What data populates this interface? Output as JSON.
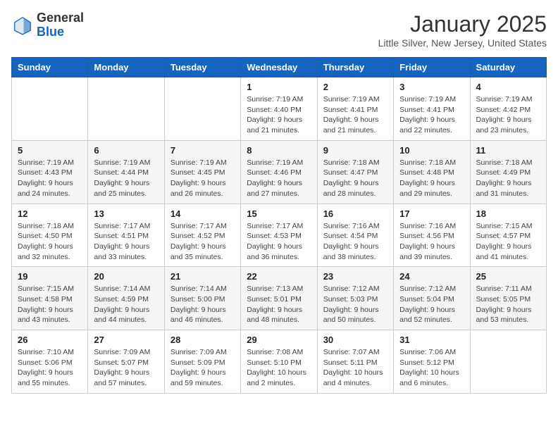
{
  "header": {
    "logo_general": "General",
    "logo_blue": "Blue",
    "month": "January 2025",
    "location": "Little Silver, New Jersey, United States"
  },
  "weekdays": [
    "Sunday",
    "Monday",
    "Tuesday",
    "Wednesday",
    "Thursday",
    "Friday",
    "Saturday"
  ],
  "weeks": [
    [
      {
        "day": "",
        "info": ""
      },
      {
        "day": "",
        "info": ""
      },
      {
        "day": "",
        "info": ""
      },
      {
        "day": "1",
        "info": "Sunrise: 7:19 AM\nSunset: 4:40 PM\nDaylight: 9 hours and 21 minutes."
      },
      {
        "day": "2",
        "info": "Sunrise: 7:19 AM\nSunset: 4:41 PM\nDaylight: 9 hours and 21 minutes."
      },
      {
        "day": "3",
        "info": "Sunrise: 7:19 AM\nSunset: 4:41 PM\nDaylight: 9 hours and 22 minutes."
      },
      {
        "day": "4",
        "info": "Sunrise: 7:19 AM\nSunset: 4:42 PM\nDaylight: 9 hours and 23 minutes."
      }
    ],
    [
      {
        "day": "5",
        "info": "Sunrise: 7:19 AM\nSunset: 4:43 PM\nDaylight: 9 hours and 24 minutes."
      },
      {
        "day": "6",
        "info": "Sunrise: 7:19 AM\nSunset: 4:44 PM\nDaylight: 9 hours and 25 minutes."
      },
      {
        "day": "7",
        "info": "Sunrise: 7:19 AM\nSunset: 4:45 PM\nDaylight: 9 hours and 26 minutes."
      },
      {
        "day": "8",
        "info": "Sunrise: 7:19 AM\nSunset: 4:46 PM\nDaylight: 9 hours and 27 minutes."
      },
      {
        "day": "9",
        "info": "Sunrise: 7:18 AM\nSunset: 4:47 PM\nDaylight: 9 hours and 28 minutes."
      },
      {
        "day": "10",
        "info": "Sunrise: 7:18 AM\nSunset: 4:48 PM\nDaylight: 9 hours and 29 minutes."
      },
      {
        "day": "11",
        "info": "Sunrise: 7:18 AM\nSunset: 4:49 PM\nDaylight: 9 hours and 31 minutes."
      }
    ],
    [
      {
        "day": "12",
        "info": "Sunrise: 7:18 AM\nSunset: 4:50 PM\nDaylight: 9 hours and 32 minutes."
      },
      {
        "day": "13",
        "info": "Sunrise: 7:17 AM\nSunset: 4:51 PM\nDaylight: 9 hours and 33 minutes."
      },
      {
        "day": "14",
        "info": "Sunrise: 7:17 AM\nSunset: 4:52 PM\nDaylight: 9 hours and 35 minutes."
      },
      {
        "day": "15",
        "info": "Sunrise: 7:17 AM\nSunset: 4:53 PM\nDaylight: 9 hours and 36 minutes."
      },
      {
        "day": "16",
        "info": "Sunrise: 7:16 AM\nSunset: 4:54 PM\nDaylight: 9 hours and 38 minutes."
      },
      {
        "day": "17",
        "info": "Sunrise: 7:16 AM\nSunset: 4:56 PM\nDaylight: 9 hours and 39 minutes."
      },
      {
        "day": "18",
        "info": "Sunrise: 7:15 AM\nSunset: 4:57 PM\nDaylight: 9 hours and 41 minutes."
      }
    ],
    [
      {
        "day": "19",
        "info": "Sunrise: 7:15 AM\nSunset: 4:58 PM\nDaylight: 9 hours and 43 minutes."
      },
      {
        "day": "20",
        "info": "Sunrise: 7:14 AM\nSunset: 4:59 PM\nDaylight: 9 hours and 44 minutes."
      },
      {
        "day": "21",
        "info": "Sunrise: 7:14 AM\nSunset: 5:00 PM\nDaylight: 9 hours and 46 minutes."
      },
      {
        "day": "22",
        "info": "Sunrise: 7:13 AM\nSunset: 5:01 PM\nDaylight: 9 hours and 48 minutes."
      },
      {
        "day": "23",
        "info": "Sunrise: 7:12 AM\nSunset: 5:03 PM\nDaylight: 9 hours and 50 minutes."
      },
      {
        "day": "24",
        "info": "Sunrise: 7:12 AM\nSunset: 5:04 PM\nDaylight: 9 hours and 52 minutes."
      },
      {
        "day": "25",
        "info": "Sunrise: 7:11 AM\nSunset: 5:05 PM\nDaylight: 9 hours and 53 minutes."
      }
    ],
    [
      {
        "day": "26",
        "info": "Sunrise: 7:10 AM\nSunset: 5:06 PM\nDaylight: 9 hours and 55 minutes."
      },
      {
        "day": "27",
        "info": "Sunrise: 7:09 AM\nSunset: 5:07 PM\nDaylight: 9 hours and 57 minutes."
      },
      {
        "day": "28",
        "info": "Sunrise: 7:09 AM\nSunset: 5:09 PM\nDaylight: 9 hours and 59 minutes."
      },
      {
        "day": "29",
        "info": "Sunrise: 7:08 AM\nSunset: 5:10 PM\nDaylight: 10 hours and 2 minutes."
      },
      {
        "day": "30",
        "info": "Sunrise: 7:07 AM\nSunset: 5:11 PM\nDaylight: 10 hours and 4 minutes."
      },
      {
        "day": "31",
        "info": "Sunrise: 7:06 AM\nSunset: 5:12 PM\nDaylight: 10 hours and 6 minutes."
      },
      {
        "day": "",
        "info": ""
      }
    ]
  ]
}
